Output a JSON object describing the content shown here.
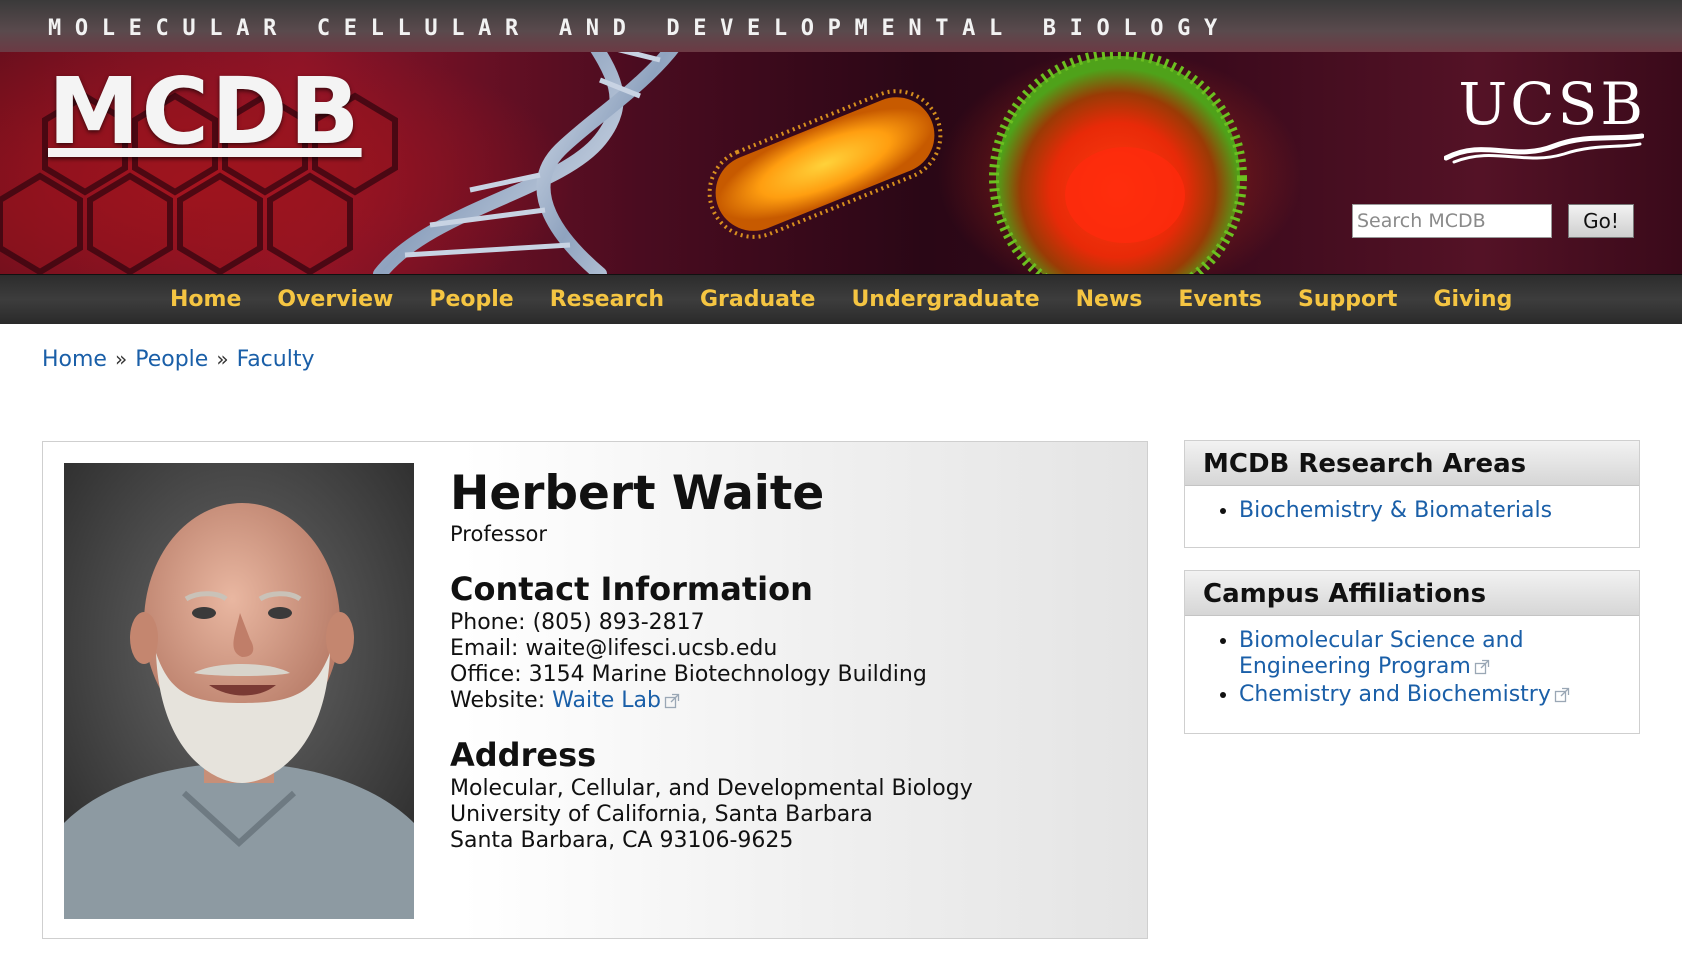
{
  "header": {
    "tagline": "MOLECULAR CELLULAR AND DEVELOPMENTAL BIOLOGY",
    "logo": "MCDB",
    "university": "UCSB",
    "search": {
      "placeholder": "Search MCDB",
      "value": "",
      "button_label": "Go!"
    }
  },
  "nav": {
    "items": [
      {
        "label": "Home"
      },
      {
        "label": "Overview"
      },
      {
        "label": "People"
      },
      {
        "label": "Research"
      },
      {
        "label": "Graduate"
      },
      {
        "label": "Undergraduate"
      },
      {
        "label": "News"
      },
      {
        "label": "Events"
      },
      {
        "label": "Support"
      },
      {
        "label": "Giving"
      }
    ]
  },
  "breadcrumb": {
    "items": [
      {
        "label": "Home"
      },
      {
        "label": "People"
      },
      {
        "label": "Faculty"
      }
    ],
    "separator": "»"
  },
  "profile": {
    "name": "Herbert Waite",
    "title": "Professor",
    "contact_heading": "Contact Information",
    "phone_label": "Phone:",
    "phone": "(805) 893-2817",
    "email_label": "Email:",
    "email": "waite@lifesci.ucsb.edu",
    "office_label": "Office:",
    "office": "3154 Marine Biotechnology Building",
    "website_label": "Website:",
    "website_link": "Waite Lab",
    "address_heading": "Address",
    "address_lines": [
      "Molecular, Cellular, and Developmental Biology",
      "University of California, Santa Barbara",
      "Santa Barbara, CA 93106-9625"
    ]
  },
  "sidebar": {
    "research": {
      "heading": "MCDB Research Areas",
      "items": [
        {
          "label": "Biochemistry & Biomaterials"
        }
      ]
    },
    "affiliations": {
      "heading": "Campus Affiliations",
      "items": [
        {
          "label": "Biomolecular Science and Engineering Program"
        },
        {
          "label": "Chemistry and Biochemistry"
        }
      ]
    }
  },
  "colors": {
    "nav_text": "#f5c542",
    "link": "#1a5fa8",
    "banner_dark": "#2a0716",
    "banner_red": "#8a1428"
  },
  "icons": {
    "external_link": "external-link-icon",
    "bullet": "disc"
  }
}
